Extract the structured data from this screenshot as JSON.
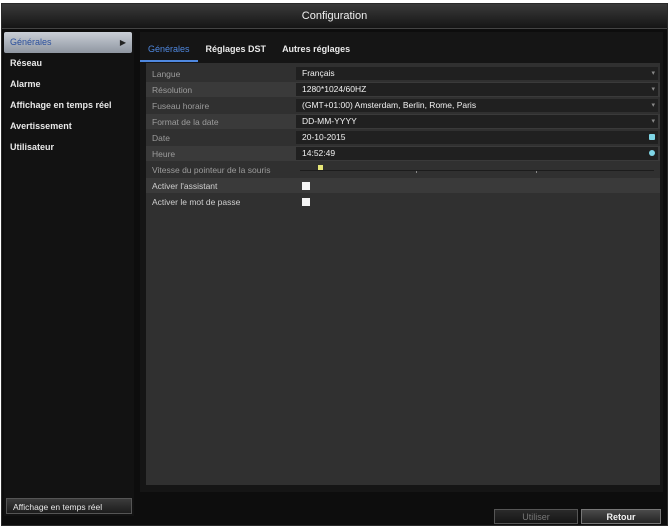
{
  "window": {
    "title": "Configuration"
  },
  "sidebar": {
    "items": [
      {
        "label": "Générales",
        "active": true
      },
      {
        "label": "Réseau"
      },
      {
        "label": "Alarme"
      },
      {
        "label": "Affichage en temps réel"
      },
      {
        "label": "Avertissement"
      },
      {
        "label": "Utilisateur"
      }
    ],
    "footer_label": "Affichage en temps réel"
  },
  "tabs": [
    {
      "label": "Générales",
      "active": true
    },
    {
      "label": "Réglages DST"
    },
    {
      "label": "Autres réglages"
    }
  ],
  "settings": {
    "langue": {
      "label": "Langue",
      "value": "Français"
    },
    "resolution": {
      "label": "Résolution",
      "value": "1280*1024/60HZ"
    },
    "fuseau": {
      "label": "Fuseau horaire",
      "value": "(GMT+01:00) Amsterdam, Berlin, Rome, Paris"
    },
    "format_date": {
      "label": "Format de la date",
      "value": "DD-MM-YYYY"
    },
    "date": {
      "label": "Date",
      "value": "20-10-2015"
    },
    "heure": {
      "label": "Heure",
      "value": "14:52:49"
    },
    "vitesse": {
      "label": "Vitesse du pointeur de la souris",
      "level": 0.05
    },
    "assistant": {
      "label": "Activer l'assistant",
      "checked": false
    },
    "mot_de_passe": {
      "label": "Activer le mot de passe",
      "checked": false
    }
  },
  "buttons": {
    "apply": "Utiliser",
    "back": "Retour"
  },
  "colors": {
    "accent": "#4f88e0",
    "icon": "#7fd6e6"
  }
}
